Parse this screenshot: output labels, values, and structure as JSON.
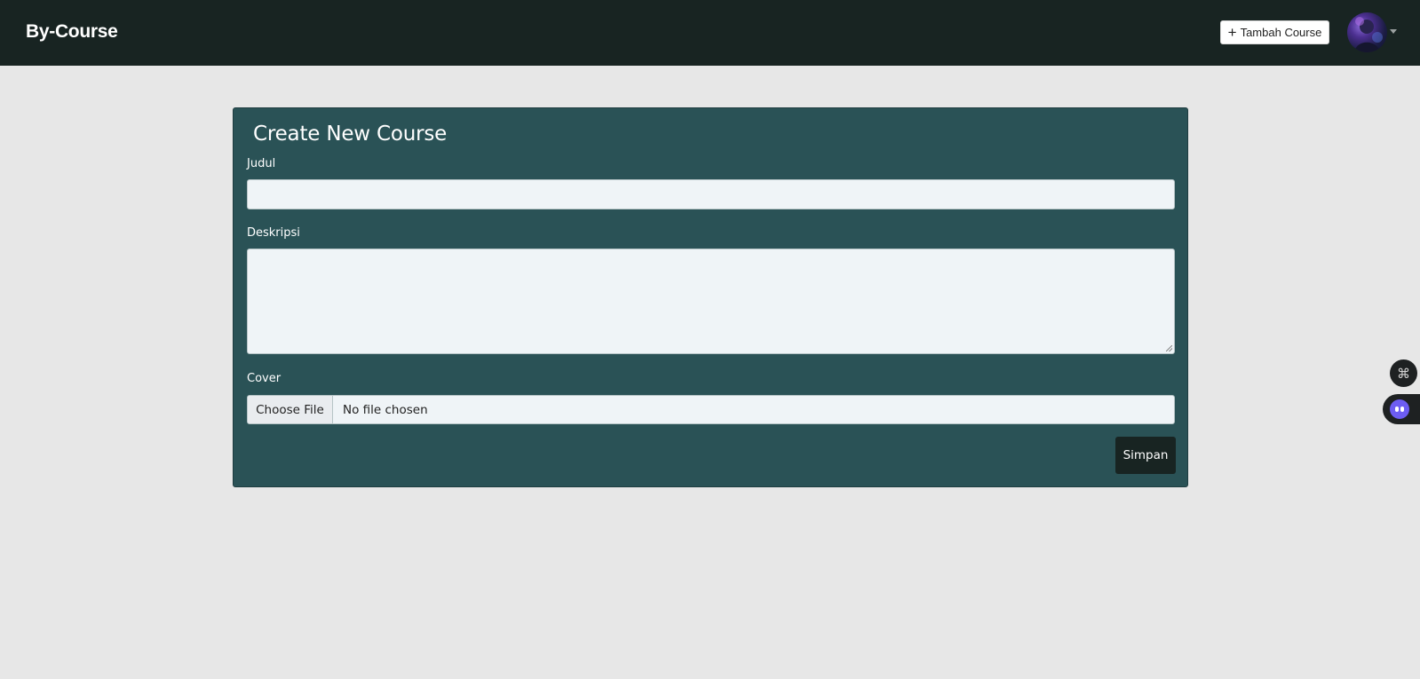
{
  "header": {
    "brand": "By-Course",
    "add_course_label": "Tambah Course",
    "add_course_icon": "plus-icon"
  },
  "form": {
    "title": "Create New Course",
    "judul_label": "Judul",
    "judul_value": "",
    "deskripsi_label": "Deskripsi",
    "deskripsi_value": "",
    "cover_label": "Cover",
    "choose_file_label": "Choose File",
    "file_status": "No file chosen",
    "submit_label": "Simpan"
  },
  "floating": {
    "command_icon": "command-icon",
    "assistant_icon": "assistant-bot-icon"
  },
  "colors": {
    "navbar_bg": "#182422",
    "card_bg": "#2a5256",
    "page_bg": "#e7e7e7",
    "input_bg": "#eff4f7",
    "submit_bg": "#182422"
  }
}
